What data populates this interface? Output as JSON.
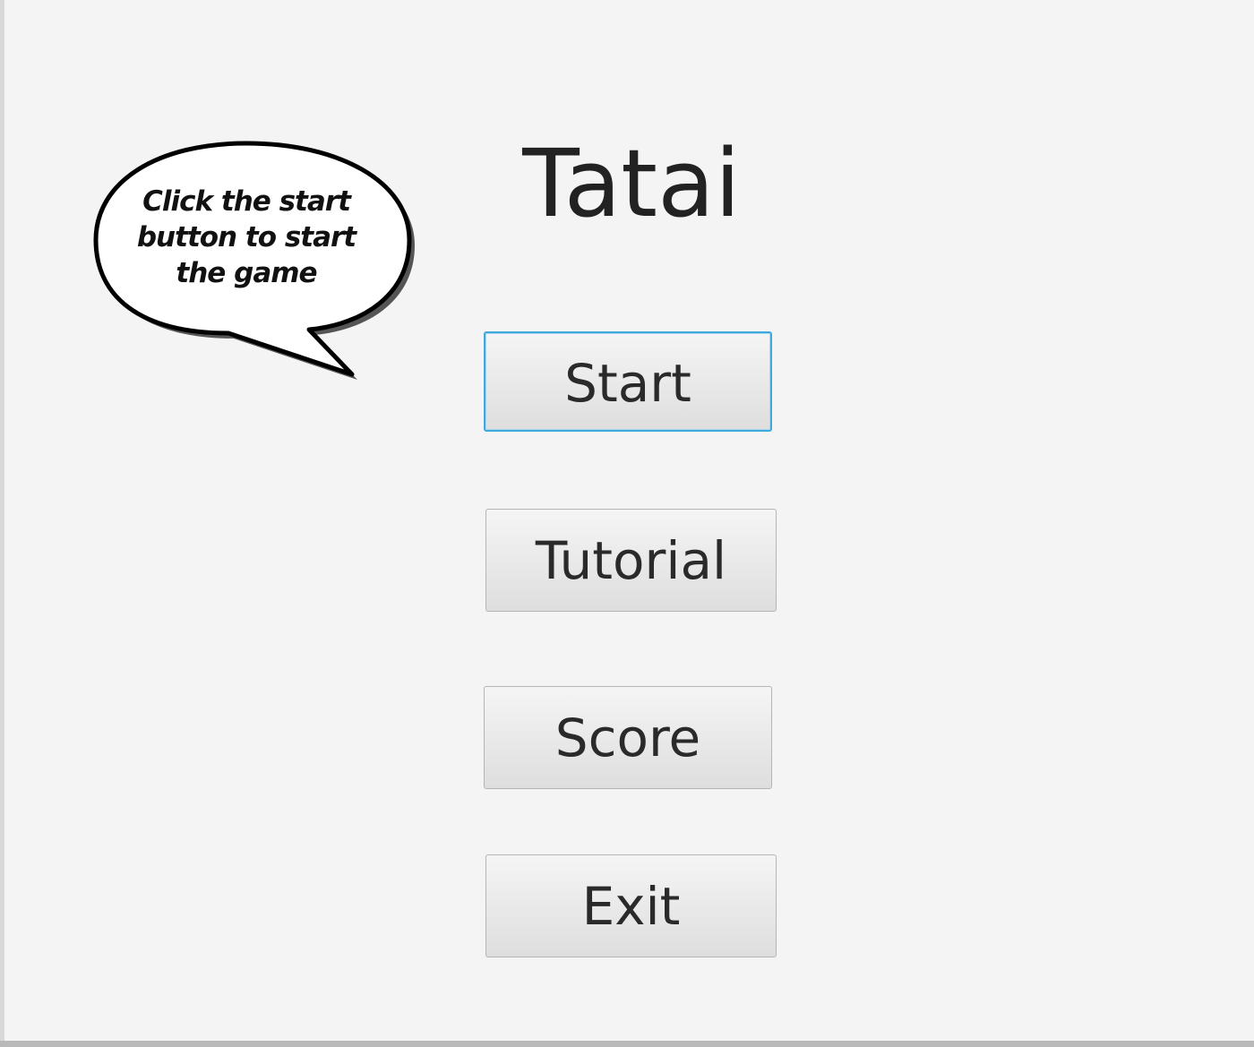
{
  "app": {
    "title": "Tatai"
  },
  "tooltip": {
    "text_line1": "Click the start",
    "text_line2": "button to start",
    "text_line3": "the game"
  },
  "menu": {
    "start_label": "Start",
    "tutorial_label": "Tutorial",
    "score_label": "Score",
    "exit_label": "Exit",
    "focused_button": "Start"
  },
  "colors": {
    "background": "#f4f4f4",
    "focus_ring": "#3fa9dc",
    "text": "#222222"
  }
}
